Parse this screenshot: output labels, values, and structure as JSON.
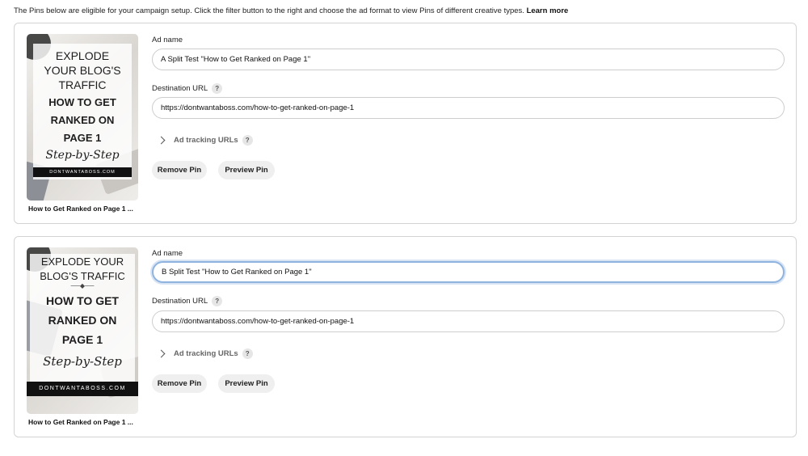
{
  "intro": {
    "text": "The Pins below are eligible for your campaign setup. Click the filter button to the right and choose the ad format to view Pins of different creative types.",
    "learn_more": "Learn more"
  },
  "form_labels": {
    "ad_name": "Ad name",
    "destination_url": "Destination URL",
    "ad_tracking": "Ad tracking URLs",
    "help": "?"
  },
  "buttons": {
    "remove": "Remove Pin",
    "preview": "Preview Pin"
  },
  "pins": [
    {
      "title": "How to Get Ranked on Page 1 ...",
      "ad_name": "A Split Test \"How to Get Ranked on Page 1\"",
      "destination_url": "https://dontwantaboss.com/how-to-get-ranked-on-page-1",
      "focused": false,
      "image": {
        "line1": "EXPLODE",
        "line2": "YOUR BLOG'S",
        "line3": "TRAFFIC",
        "line4": "HOW TO GET",
        "line5": "RANKED ON",
        "line6": "PAGE 1",
        "script": "Step-by-Step",
        "site": "DONTWANTABOSS.COM"
      }
    },
    {
      "title": "How to Get Ranked on Page 1 ...",
      "ad_name": "B Split Test \"How to Get Ranked on Page 1\"",
      "destination_url": "https://dontwantaboss.com/how-to-get-ranked-on-page-1",
      "focused": true,
      "image": {
        "line1": "EXPLODE YOUR",
        "line2": "BLOG'S TRAFFIC",
        "line4": "HOW TO GET",
        "line5": "RANKED ON",
        "line6": "PAGE 1",
        "script": "Step-by-Step",
        "site": "DONTWANTABOSS.COM"
      }
    }
  ]
}
